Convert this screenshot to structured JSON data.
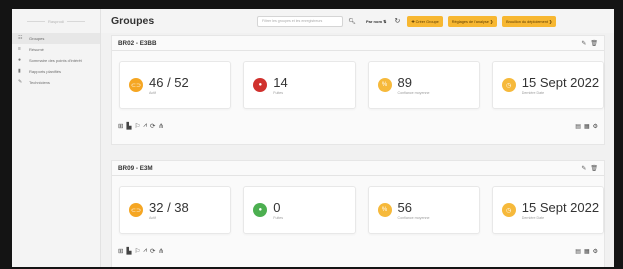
{
  "sidebar": {
    "project_label": "Rasprodi",
    "items": [
      {
        "icon": "list-icon",
        "glyph": "☷",
        "label": "Groupes"
      },
      {
        "icon": "menu-icon",
        "glyph": "≡",
        "label": "Résumé"
      },
      {
        "icon": "location-icon",
        "glyph": "●",
        "label": "Sommaire des points d'intérêt"
      },
      {
        "icon": "document-icon",
        "glyph": "▮",
        "label": "Rapports planifiés"
      },
      {
        "icon": "wrench-icon",
        "glyph": "✎",
        "label": "Techniciens"
      }
    ]
  },
  "header": {
    "title": "Groupes",
    "search_placeholder": "Filtrer les groupes et les enregistreurs",
    "sort_label": "Par nom ⇅",
    "buttons": {
      "create": "✚ Créer Groupe",
      "analysis": "Réglages de l'analyse ❯",
      "draft": "Brouillon du déploiement ❯"
    }
  },
  "groups": [
    {
      "name": "BR02 - E3BB",
      "stats": [
        {
          "icon": "toggle-icon",
          "color": "#f5a623",
          "value": "46 / 52",
          "label": "Actif"
        },
        {
          "icon": "drop-icon",
          "color": "#d0312d",
          "value": "14",
          "label": "Fuites"
        },
        {
          "icon": "percent-icon",
          "color": "#f6b93b",
          "value": "89",
          "label": "Confiance moyenne"
        },
        {
          "icon": "clock-icon",
          "color": "#f6b93b",
          "value": "15 Sept 2022",
          "label": "Dernière Date"
        }
      ]
    },
    {
      "name": "BR09 - E3M",
      "stats": [
        {
          "icon": "toggle-icon",
          "color": "#f5a623",
          "value": "32 / 38",
          "label": "Actif"
        },
        {
          "icon": "drop-icon",
          "color": "#4caf50",
          "value": "0",
          "label": "Fuites"
        },
        {
          "icon": "percent-icon",
          "color": "#f6b93b",
          "value": "56",
          "label": "Confiance moyenne"
        },
        {
          "icon": "clock-icon",
          "color": "#f6b93b",
          "value": "15 Sept 2022",
          "label": "Dernière Date"
        }
      ]
    }
  ]
}
